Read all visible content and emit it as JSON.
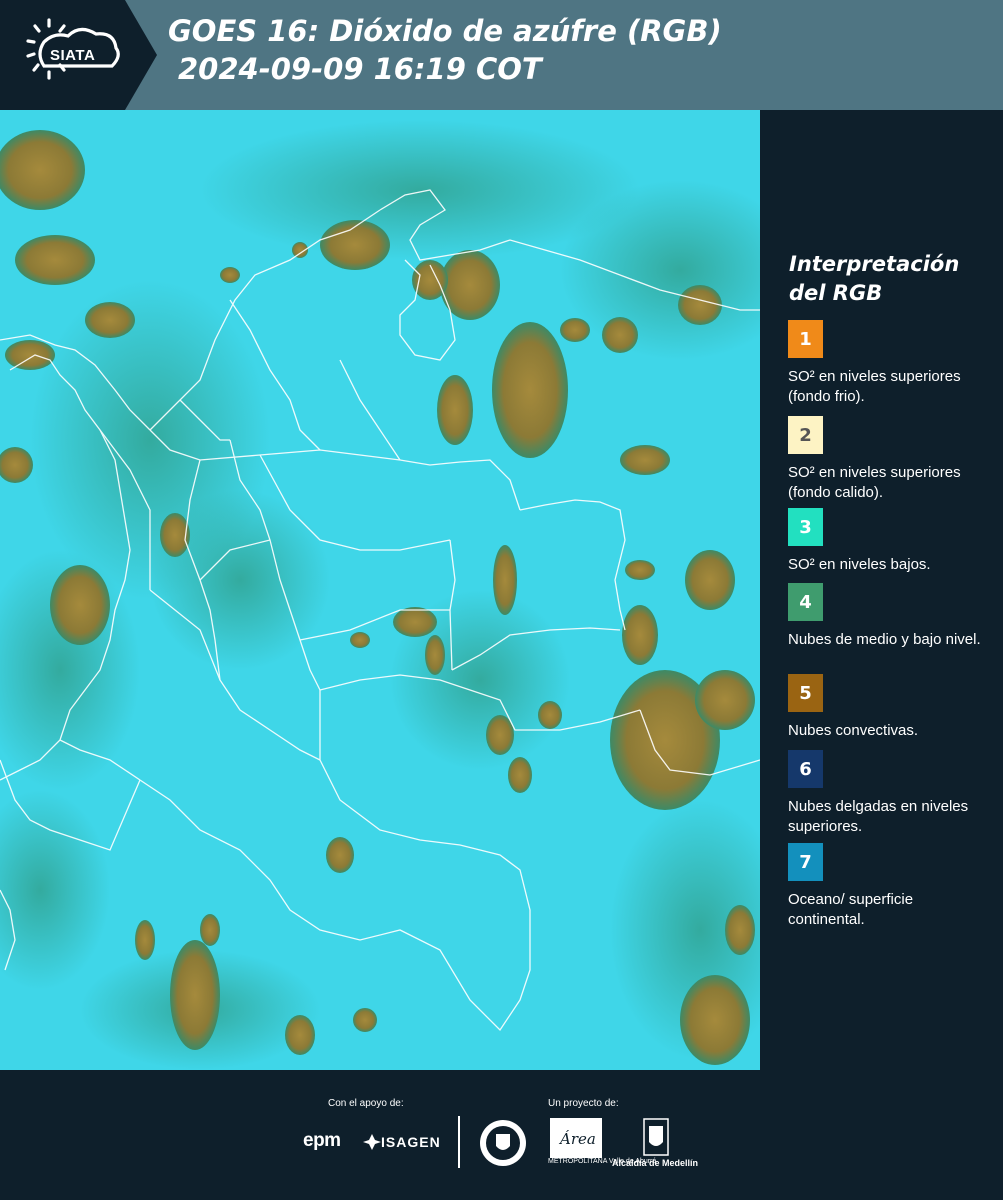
{
  "header": {
    "logo_text": "SIATA",
    "title": "GOES 16: Dióxido de azúfre (RGB)",
    "datetime": "2024-09-09 16:19 COT",
    "background_color": "#4f7583",
    "logo_panel_color": "#0e1f2b"
  },
  "map": {
    "background_color": "#3fd6e8",
    "convective_cloud_color": "#a48a3a",
    "low_cloud_color": "#3e9b7c",
    "border_color": "#ffffff"
  },
  "legend": {
    "title": "Interpretación del RGB",
    "items": [
      {
        "number": "1",
        "color": "#f08a19",
        "number_color": "#ffffff",
        "label": "SO² en niveles superiores (fondo frio)."
      },
      {
        "number": "2",
        "color": "#fdf3c4",
        "number_color": "#555555",
        "label": "SO² en niveles superiores (fondo calido)."
      },
      {
        "number": "3",
        "color": "#22e0c0",
        "number_color": "#ffffff",
        "label": "SO² en niveles bajos."
      },
      {
        "number": "4",
        "color": "#3f9c6e",
        "number_color": "#ffffff",
        "label": "Nubes de medio y bajo nivel."
      },
      {
        "number": "5",
        "color": "#9a6412",
        "number_color": "#ffffff",
        "label": "Nubes convectivas."
      },
      {
        "number": "6",
        "color": "#15386b",
        "number_color": "#ffffff",
        "label": "Nubes delgadas en niveles superiores."
      },
      {
        "number": "7",
        "color": "#1390bd",
        "number_color": "#ffffff",
        "label": "Oceano/ superficie continental."
      }
    ]
  },
  "footer": {
    "support_label": "Con el apoyo de:",
    "project_label": "Un proyecto de:",
    "epm": "epm",
    "isagen": "ISAGEN",
    "amva": "METROPOLITANA Valle de Aburrá",
    "alcaldia": "Alcaldía de Medellín"
  }
}
